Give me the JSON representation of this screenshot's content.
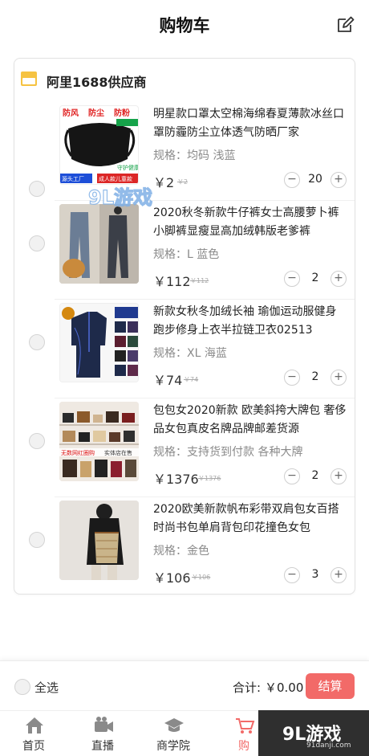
{
  "header": {
    "title": "购物车",
    "edit_icon": "edit-icon"
  },
  "shop": {
    "name": "阿里1688供应商",
    "icon": "shop-icon"
  },
  "items": [
    {
      "name": "明星款口罩太空棉海绵春夏薄款冰丝口罩防霾防尘立体透气防晒厂家",
      "spec": "规格：均码 浅蓝",
      "price": "￥2",
      "old_price": "￥2",
      "qty": "20",
      "thumb_text": [
        "防风",
        "防尘",
        "防粉",
        "源头工厂",
        "成人款儿童款",
        "守护健康"
      ]
    },
    {
      "name": "2020秋冬新款牛仔裤女士高腰萝卜裤小脚裤显瘦显高加绒韩版老爹裤",
      "spec": "规格：L 蓝色",
      "price": "￥112",
      "old_price": "￥112",
      "qty": "2"
    },
    {
      "name": "新款女秋冬加绒长袖 瑜伽运动服健身跑步修身上衣半拉链卫衣02513",
      "spec": "规格：XL 海蓝",
      "price": "￥74",
      "old_price": "￥74",
      "qty": "2"
    },
    {
      "name": "包包女2020新款 欧美斜挎大牌包 奢侈品女包真皮名牌品牌邮差货源",
      "spec": "规格：支持货到付款 各种大牌",
      "price": "￥1376",
      "old_price": "￥1376",
      "qty": "2",
      "thumb_text": [
        "无数网红圈购",
        "实体店在售"
      ]
    },
    {
      "name": "2020欧美新款帆布彩带双肩包女百搭时尚书包单肩背包印花撞色女包",
      "spec": "规格：金色",
      "price": "￥106",
      "old_price": "￥106",
      "qty": "3"
    }
  ],
  "stepper": {
    "minus": "−",
    "plus": "+"
  },
  "footer": {
    "select_all": "全选",
    "total_label": "合计:",
    "total_value": "￥0.00",
    "checkout": "结算"
  },
  "tabs": [
    {
      "label": "首页",
      "icon": "home-icon"
    },
    {
      "label": "直播",
      "icon": "video-camera-icon"
    },
    {
      "label": "商学院",
      "icon": "graduation-cap-icon"
    },
    {
      "label": "购",
      "icon": "cart-icon"
    }
  ],
  "watermark": {
    "text": "9L游戏",
    "url_text": "91danji.com",
    "mid_text": "9L游戏"
  },
  "colors": {
    "accent": "#f26a68",
    "shop_icon": "#f6c342"
  }
}
